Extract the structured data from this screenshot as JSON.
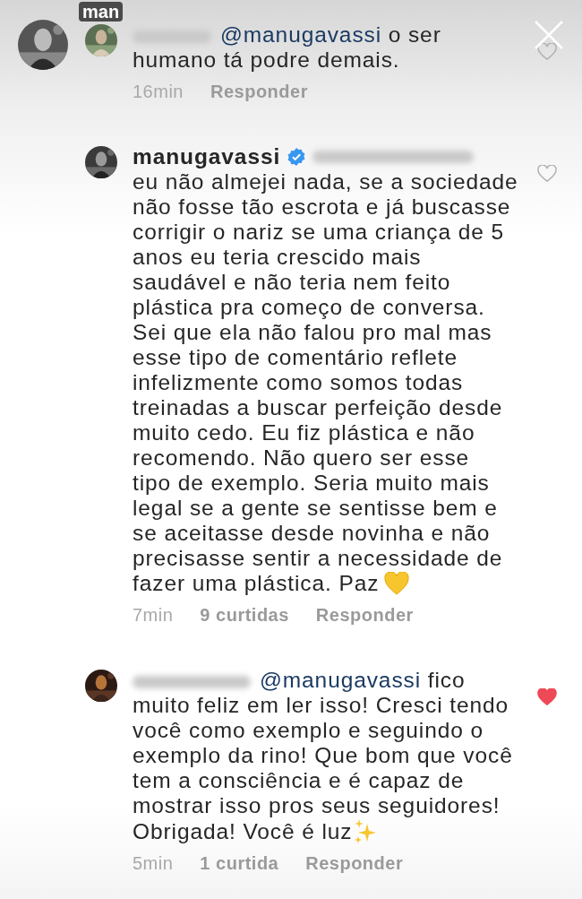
{
  "story": {
    "username": "man"
  },
  "comments": [
    {
      "author": {
        "kind": "blurred"
      },
      "mention": "@manugavassi",
      "text": " o ser\nhumano tá podre demais.",
      "time": "16min",
      "reply": "Responder",
      "liked": false
    },
    {
      "author": {
        "kind": "named",
        "name": "manugavassi",
        "verified": true
      },
      "mention_blurred": true,
      "text": "eu não almejei nada, se a sociedade\nnão fosse tão escrota e já buscasse\ncorrigir o nariz se uma criança de 5\nanos eu teria crescido mais\nsaudável e não teria nem feito\nplástica pra começo de conversa.\nSei que ela não falou pro mal mas\nesse tipo de comentário reflete\ninfelizmente como somos todas\ntreinadas a buscar perfeição desde\nmuito cedo. Eu fiz plástica e não\nrecomendo. Não quero ser esse\ntipo de exemplo. Seria muito mais\nlegal se a gente se sentisse bem e\nse aceitasse desde novinha e não\nprecisasse sentir a necessidade de\nfazer uma plástica. Paz",
      "end_icon": {
        "kind": "heart"
      },
      "time": "7min",
      "likes": "9 curtidas",
      "reply": "Responder",
      "liked": false
    },
    {
      "author": {
        "kind": "blurred"
      },
      "mention": "@manugavassi",
      "text": " fico\nmuito feliz em ler isso! Cresci tendo\nvocê como exemplo e seguindo o\nexemplo da rino! Que bom que você\ntem a consciência e é capaz de\nmostrar isso pros seus seguidores!\nObrigada! Você é luz",
      "end_icon": {
        "kind": "sparkles"
      },
      "time": "5min",
      "likes": "1 curtida",
      "reply": "Responder",
      "liked": true
    }
  ]
}
